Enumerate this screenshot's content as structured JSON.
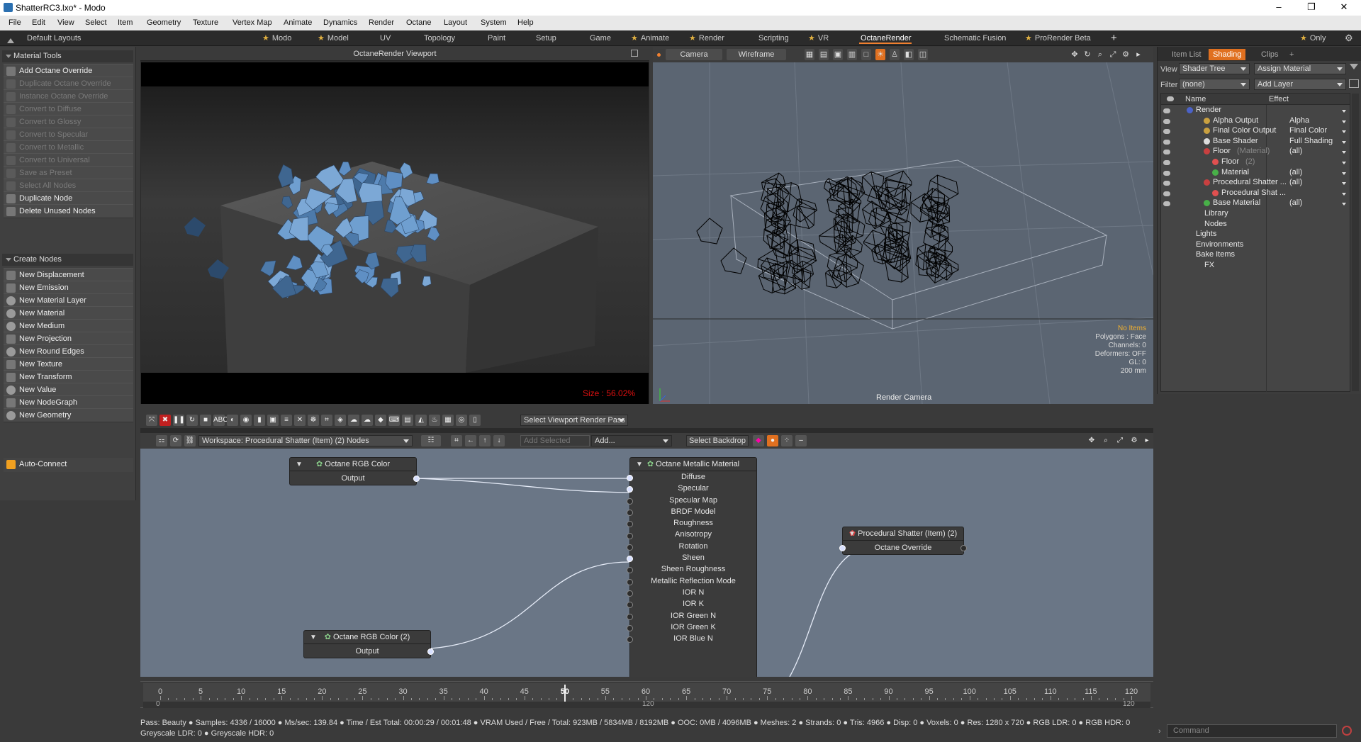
{
  "window": {
    "title": "ShatterRC3.lxo* - Modo",
    "min": "–",
    "max": "❐",
    "close": "✕"
  },
  "menu": [
    "File",
    "Edit",
    "View",
    "Select",
    "Item",
    "Geometry",
    "Texture",
    "Vertex Map",
    "Animate",
    "Dynamics",
    "Render",
    "Octane",
    "Layout",
    "System",
    "Help"
  ],
  "layouts": {
    "default": "Default Layouts",
    "tabs": [
      "Modo",
      "Model",
      "UV",
      "Topology",
      "Paint",
      "Setup",
      "Game",
      "Animate",
      "Render",
      "Scripting",
      "VR",
      "OctaneRender",
      "Schematic Fusion",
      "ProRender Beta"
    ],
    "only": "Only"
  },
  "left": {
    "section1": "Material Tools",
    "tools1": [
      {
        "label": "Add Octane Override",
        "enabled": true
      },
      {
        "label": "Duplicate Octane Override",
        "enabled": false
      },
      {
        "label": "Instance Octane Override",
        "enabled": false
      },
      {
        "label": "Convert to Diffuse",
        "enabled": false
      },
      {
        "label": "Convert to Glossy",
        "enabled": false
      },
      {
        "label": "Convert to Specular",
        "enabled": false
      },
      {
        "label": "Convert to Metallic",
        "enabled": false
      },
      {
        "label": "Convert to Universal",
        "enabled": false
      },
      {
        "label": "Save as Preset",
        "enabled": false
      },
      {
        "label": "Select All Nodes",
        "enabled": false
      },
      {
        "label": "Duplicate Node",
        "enabled": true
      },
      {
        "label": "Delete Unused Nodes",
        "enabled": true
      }
    ],
    "section2": "Create Nodes",
    "tools2": [
      "New Displacement",
      "New Emission",
      "New Material Layer",
      "New Material",
      "New Medium",
      "New Projection",
      "New Round Edges",
      "New Texture",
      "New Transform",
      "New Value",
      "New NodeGraph",
      "New Geometry"
    ],
    "autoconnect": "Auto-Connect"
  },
  "viewport1": {
    "title": "OctaneRender Viewport",
    "size": "Size : 56.02%"
  },
  "viewport2": {
    "camera": "Camera",
    "mode": "Wireframe",
    "info": [
      "No Items",
      "Polygons : Face",
      "Channels: 0",
      "Deformers: OFF",
      "GL: 0",
      "200 mm"
    ],
    "label": "Render Camera"
  },
  "right": {
    "tabs": [
      "Item List",
      "Shading",
      "Clips"
    ],
    "view_label": "View",
    "view_value": "Shader Tree",
    "assign": "Assign Material",
    "filter_label": "Filter",
    "filter_value": "(none)",
    "add_layer": "Add Layer",
    "col_name": "Name",
    "col_effect": "Effect",
    "rows": [
      {
        "name": "Render",
        "effect": "",
        "indent": 0
      },
      {
        "name": "Alpha Output",
        "effect": "Alpha",
        "indent": 2
      },
      {
        "name": "Final Color Output",
        "effect": "Final Color",
        "indent": 2
      },
      {
        "name": "Base Shader",
        "effect": "Full Shading",
        "indent": 2
      },
      {
        "name": "Floor",
        "suffix": "(Material)",
        "effect": "(all)",
        "indent": 2
      },
      {
        "name": "Floor",
        "suffix": "(2)",
        "effect": "",
        "indent": 3
      },
      {
        "name": "Material",
        "effect": "(all)",
        "indent": 3
      },
      {
        "name": "Procedural Shatter ...",
        "effect": "(all)",
        "indent": 2
      },
      {
        "name": "Procedural Shat ...",
        "effect": "",
        "indent": 3
      },
      {
        "name": "Base Material",
        "effect": "(all)",
        "indent": 2
      },
      {
        "name": "Library",
        "effect": "",
        "indent": 1
      },
      {
        "name": "Nodes",
        "effect": "",
        "indent": 1
      },
      {
        "name": "Lights",
        "effect": "",
        "indent": 0
      },
      {
        "name": "Environments",
        "effect": "",
        "indent": 0
      },
      {
        "name": "Bake Items",
        "effect": "",
        "indent": 0
      },
      {
        "name": "FX",
        "effect": "",
        "indent": 1
      }
    ]
  },
  "nodebar": {
    "render_pass": "Select Viewport Render Pass"
  },
  "nodebar2": {
    "workspace": "Workspace: Procedural Shatter (Item) (2) Nodes",
    "add_selected": "Add Selected",
    "add": "Add...",
    "backdrop": "Select Backdrop"
  },
  "nodes": {
    "rgb1": {
      "title": "Octane RGB Color",
      "out": "Output"
    },
    "rgb2": {
      "title": "Octane RGB Color (2)",
      "out": "Output"
    },
    "metal": {
      "title": "Octane Metallic Material",
      "inputs": [
        "Diffuse",
        "Specular",
        "Specular Map",
        "BRDF Model",
        "Roughness",
        "Anisotropy",
        "Rotation",
        "Sheen",
        "Sheen Roughness",
        "Metallic Reflection Mode",
        "IOR N",
        "IOR K",
        "IOR Green N",
        "IOR Green K",
        "IOR Blue N"
      ]
    },
    "shatter": {
      "title": "Procedural Shatter (Item) (2)",
      "port": "Octane Override"
    }
  },
  "timeline": {
    "labels": [
      "0",
      "5",
      "10",
      "15",
      "20",
      "25",
      "30",
      "35",
      "40",
      "45",
      "50",
      "55",
      "60",
      "65",
      "70",
      "75",
      "80",
      "85",
      "90",
      "95",
      "100",
      "105",
      "110",
      "115",
      "120"
    ],
    "current": "50",
    "sub_left": "0",
    "sub_mid": "120",
    "sub_right": "120"
  },
  "status": {
    "line1": "Pass: Beauty ● Samples: 4336  / 16000 ● Ms/sec: 139.84 ● Time / Est Total: 00:00:29 / 00:01:48 ● VRAM Used / Free / Total: 923MB / 5834MB / 8192MB ● OOC: 0MB / 4096MB ● Meshes: 2 ● Strands: 0 ● Tris: 4966 ● Disp: 0 ● Voxels: 0 ● Res: 1280 x 720 ● RGB LDR: 0 ● RGB HDR: 0",
    "line2": "Greyscale LDR: 0 ● Greyscale HDR: 0"
  },
  "command": {
    "placeholder": "Command"
  },
  "colors": {
    "accent": "#f08030",
    "graph_bg": "#6a7686",
    "chunk": "#6f9fd0"
  }
}
